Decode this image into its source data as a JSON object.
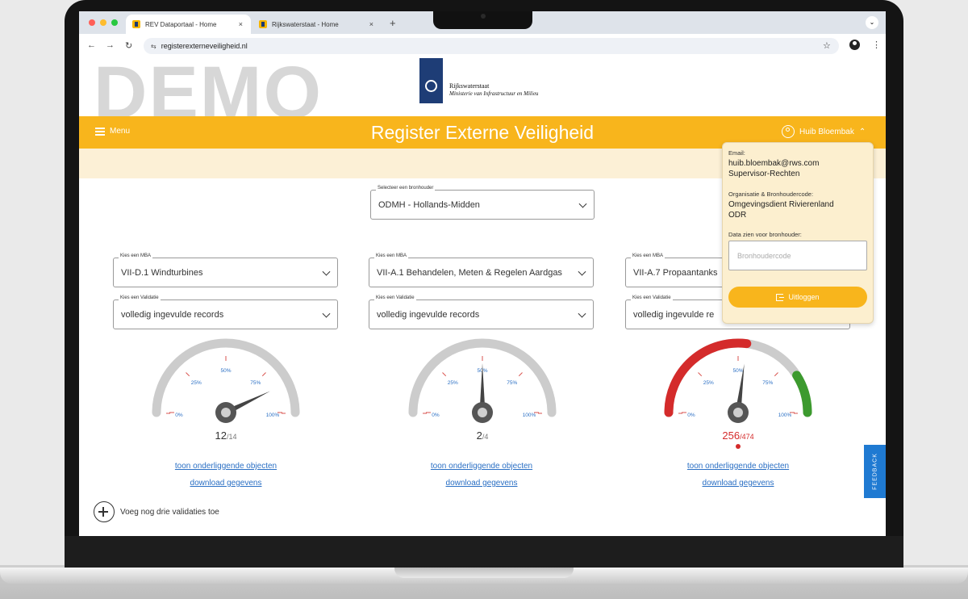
{
  "browser": {
    "tabs": [
      {
        "label": "REV Dataportaal - Home",
        "close": "×"
      },
      {
        "label": "Rijkswaterstaat - Home",
        "close": "×"
      }
    ],
    "new_tab": "+",
    "url": "registerexterneveiligheid.nl",
    "back": "←",
    "forward": "→",
    "reload": "↻",
    "star": "☆",
    "more": "⋮"
  },
  "page": {
    "watermark": "DEMO",
    "logo": {
      "line1": "Rijkswaterstaat",
      "line2": "Ministerie van Infrastructuur en Milieu"
    },
    "header": {
      "menu_label": "Menu",
      "title": "Register Externe Veiligheid",
      "user_name": "Huib Bloembak",
      "user_chevron": "⌃"
    },
    "bronhouder": {
      "label": "Selecteer een bronhouder",
      "value": "ODMH - Hollands-Midden"
    },
    "panels": [
      {
        "mba_label": "Kies een MBA",
        "mba_value": "VII-D.1 Windturbines",
        "val_label": "Kies een Validatie",
        "val_value": "volledig ingevulde records",
        "gauge": {
          "numerator": "12",
          "denominator": "/14",
          "fraction": 0.857,
          "colored": false,
          "red_indicator": false
        }
      },
      {
        "mba_label": "Kies een MBA",
        "mba_value": "VII-A.1 Behandelen, Meten & Regelen Aardgas",
        "val_label": "Kies een Validatie",
        "val_value": "volledig ingevulde records",
        "gauge": {
          "numerator": "2",
          "denominator": "/4",
          "fraction": 0.5,
          "colored": false,
          "red_indicator": false
        }
      },
      {
        "mba_label": "Kies een MBA",
        "mba_value": "VII-A.7 Propaantanks",
        "val_label": "Kies een Validatie",
        "val_value": "volledig ingevulde re",
        "gauge": {
          "numerator": "256",
          "denominator": "/474",
          "fraction": 0.54,
          "colored": true,
          "red_indicator": true
        }
      }
    ],
    "gauge_labels": {
      "p0": "0%",
      "p25": "25%",
      "p50": "50%",
      "p75": "75%",
      "p100": "100%"
    },
    "gauge_colors": {
      "track": "#cccccc",
      "needle": "#444444",
      "red": "#d42b2b",
      "green": "#3c9a2e",
      "tick_red": "#d9534f",
      "label": "#2a6fc4"
    },
    "links": {
      "objects": "toon onderliggende objecten",
      "download": "download gegevens"
    },
    "add_validations": "Voeg nog drie validaties toe",
    "feedback": "FEEDBACK",
    "user_popup": {
      "email_label": "Email:",
      "email": "huib.bloembak@rws.com",
      "role": "Supervisor-Rechten",
      "org_label": "Organisatie & Bronhoudercode:",
      "org_name": "Omgevingsdient Rivierenland",
      "org_code": "ODR",
      "data_label": "Data zien voor bronhouder:",
      "input_placeholder": "Bronhoudercode",
      "logout": "Uitloggen"
    }
  }
}
